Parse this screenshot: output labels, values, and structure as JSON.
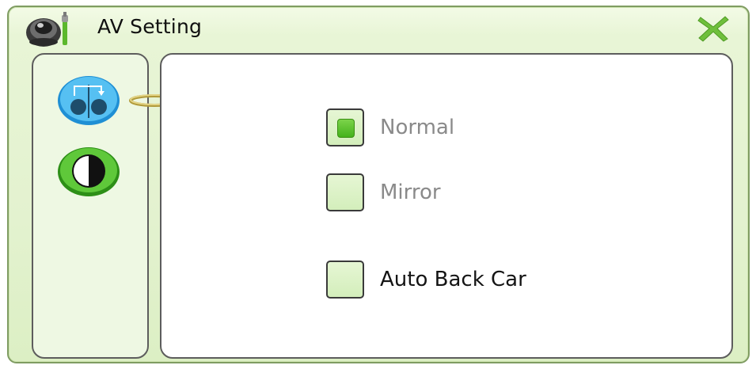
{
  "window": {
    "title": "AV Setting",
    "close_label": "Close"
  },
  "sidebar": {
    "items": [
      {
        "name": "mirror",
        "icon": "mirror-flip-icon",
        "selected": true
      },
      {
        "name": "contrast",
        "icon": "contrast-icon",
        "selected": false
      }
    ]
  },
  "options": [
    {
      "label": "Normal",
      "checked": true,
      "enabled": false
    },
    {
      "label": "Mirror",
      "checked": false,
      "enabled": false
    },
    {
      "label": "Auto Back Car",
      "checked": false,
      "enabled": true
    }
  ],
  "colors": {
    "frame": "#7f9c62",
    "background": "#e3f2cf",
    "accent_green": "#45b21c",
    "accent_blue": "#2fa8e8"
  }
}
